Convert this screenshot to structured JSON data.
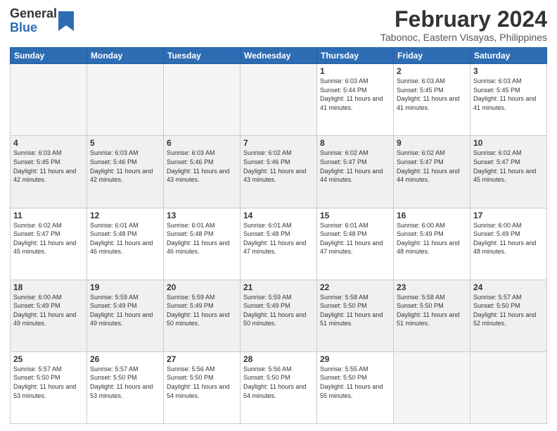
{
  "header": {
    "logo_general": "General",
    "logo_blue": "Blue",
    "month_title": "February 2024",
    "subtitle": "Tabonoc, Eastern Visayas, Philippines"
  },
  "days_of_week": [
    "Sunday",
    "Monday",
    "Tuesday",
    "Wednesday",
    "Thursday",
    "Friday",
    "Saturday"
  ],
  "weeks": [
    [
      {
        "day": "",
        "empty": true
      },
      {
        "day": "",
        "empty": true
      },
      {
        "day": "",
        "empty": true
      },
      {
        "day": "",
        "empty": true
      },
      {
        "day": "1",
        "sunrise": "6:03 AM",
        "sunset": "5:44 PM",
        "daylight": "11 hours and 41 minutes."
      },
      {
        "day": "2",
        "sunrise": "6:03 AM",
        "sunset": "5:45 PM",
        "daylight": "11 hours and 41 minutes."
      },
      {
        "day": "3",
        "sunrise": "6:03 AM",
        "sunset": "5:45 PM",
        "daylight": "11 hours and 41 minutes."
      }
    ],
    [
      {
        "day": "4",
        "sunrise": "6:03 AM",
        "sunset": "5:45 PM",
        "daylight": "11 hours and 42 minutes."
      },
      {
        "day": "5",
        "sunrise": "6:03 AM",
        "sunset": "5:46 PM",
        "daylight": "11 hours and 42 minutes."
      },
      {
        "day": "6",
        "sunrise": "6:03 AM",
        "sunset": "5:46 PM",
        "daylight": "11 hours and 43 minutes."
      },
      {
        "day": "7",
        "sunrise": "6:02 AM",
        "sunset": "5:46 PM",
        "daylight": "11 hours and 43 minutes."
      },
      {
        "day": "8",
        "sunrise": "6:02 AM",
        "sunset": "5:47 PM",
        "daylight": "11 hours and 44 minutes."
      },
      {
        "day": "9",
        "sunrise": "6:02 AM",
        "sunset": "5:47 PM",
        "daylight": "11 hours and 44 minutes."
      },
      {
        "day": "10",
        "sunrise": "6:02 AM",
        "sunset": "5:47 PM",
        "daylight": "11 hours and 45 minutes."
      }
    ],
    [
      {
        "day": "11",
        "sunrise": "6:02 AM",
        "sunset": "5:47 PM",
        "daylight": "11 hours and 45 minutes."
      },
      {
        "day": "12",
        "sunrise": "6:01 AM",
        "sunset": "5:48 PM",
        "daylight": "11 hours and 46 minutes."
      },
      {
        "day": "13",
        "sunrise": "6:01 AM",
        "sunset": "5:48 PM",
        "daylight": "11 hours and 46 minutes."
      },
      {
        "day": "14",
        "sunrise": "6:01 AM",
        "sunset": "5:48 PM",
        "daylight": "11 hours and 47 minutes."
      },
      {
        "day": "15",
        "sunrise": "6:01 AM",
        "sunset": "5:48 PM",
        "daylight": "11 hours and 47 minutes."
      },
      {
        "day": "16",
        "sunrise": "6:00 AM",
        "sunset": "5:49 PM",
        "daylight": "11 hours and 48 minutes."
      },
      {
        "day": "17",
        "sunrise": "6:00 AM",
        "sunset": "5:49 PM",
        "daylight": "11 hours and 48 minutes."
      }
    ],
    [
      {
        "day": "18",
        "sunrise": "6:00 AM",
        "sunset": "5:49 PM",
        "daylight": "11 hours and 49 minutes."
      },
      {
        "day": "19",
        "sunrise": "5:59 AM",
        "sunset": "5:49 PM",
        "daylight": "11 hours and 49 minutes."
      },
      {
        "day": "20",
        "sunrise": "5:59 AM",
        "sunset": "5:49 PM",
        "daylight": "11 hours and 50 minutes."
      },
      {
        "day": "21",
        "sunrise": "5:59 AM",
        "sunset": "5:49 PM",
        "daylight": "11 hours and 50 minutes."
      },
      {
        "day": "22",
        "sunrise": "5:58 AM",
        "sunset": "5:50 PM",
        "daylight": "11 hours and 51 minutes."
      },
      {
        "day": "23",
        "sunrise": "5:58 AM",
        "sunset": "5:50 PM",
        "daylight": "11 hours and 51 minutes."
      },
      {
        "day": "24",
        "sunrise": "5:57 AM",
        "sunset": "5:50 PM",
        "daylight": "11 hours and 52 minutes."
      }
    ],
    [
      {
        "day": "25",
        "sunrise": "5:57 AM",
        "sunset": "5:50 PM",
        "daylight": "11 hours and 53 minutes."
      },
      {
        "day": "26",
        "sunrise": "5:57 AM",
        "sunset": "5:50 PM",
        "daylight": "11 hours and 53 minutes."
      },
      {
        "day": "27",
        "sunrise": "5:56 AM",
        "sunset": "5:50 PM",
        "daylight": "11 hours and 54 minutes."
      },
      {
        "day": "28",
        "sunrise": "5:56 AM",
        "sunset": "5:50 PM",
        "daylight": "11 hours and 54 minutes."
      },
      {
        "day": "29",
        "sunrise": "5:55 AM",
        "sunset": "5:50 PM",
        "daylight": "11 hours and 55 minutes."
      },
      {
        "day": "",
        "empty": true
      },
      {
        "day": "",
        "empty": true
      }
    ]
  ],
  "labels": {
    "sunrise": "Sunrise: ",
    "sunset": "Sunset: ",
    "daylight": "Daylight: "
  }
}
